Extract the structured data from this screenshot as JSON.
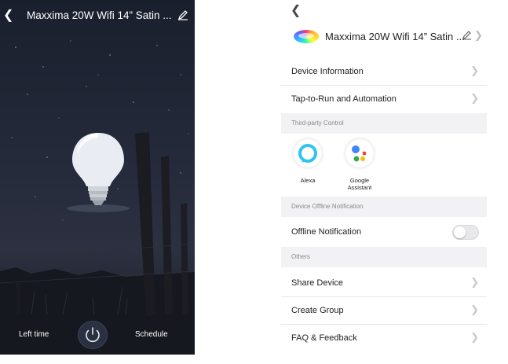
{
  "left_screen": {
    "title": "Maxxima 20W Wifi 14” Satin ...",
    "icons": {
      "back": "chevron-left-icon",
      "edit": "pencil-icon",
      "power": "power-icon",
      "bulb": "light-bulb-icon"
    },
    "bottom": {
      "left_time_label": "Left time",
      "schedule_label": "Schedule"
    }
  },
  "right_screen": {
    "icons": {
      "back": "chevron-left-icon",
      "device": "rgb-light-icon",
      "edit": "pencil-icon"
    },
    "device_name": "Maxxima 20W Wifi 14” Satin ...",
    "rows": {
      "device_information": "Device Information",
      "tap_to_run": "Tap-to-Run and Automation",
      "offline_notification": "Offline Notification",
      "share_device": "Share Device",
      "create_group": "Create Group",
      "faq_feedback": "FAQ & Feedback"
    },
    "sections": {
      "third_party": "Third-party Control",
      "offline": "Device Offline Notification",
      "others": "Others"
    },
    "third_party": {
      "alexa": "Alexa",
      "google_line1": "Google",
      "google_line2": "Assistant"
    },
    "offline_notification_enabled": false
  },
  "colors": {
    "dark_bg": "#1f2433",
    "section_bg": "#f2f2f4",
    "alexa": "#31c4f3"
  }
}
